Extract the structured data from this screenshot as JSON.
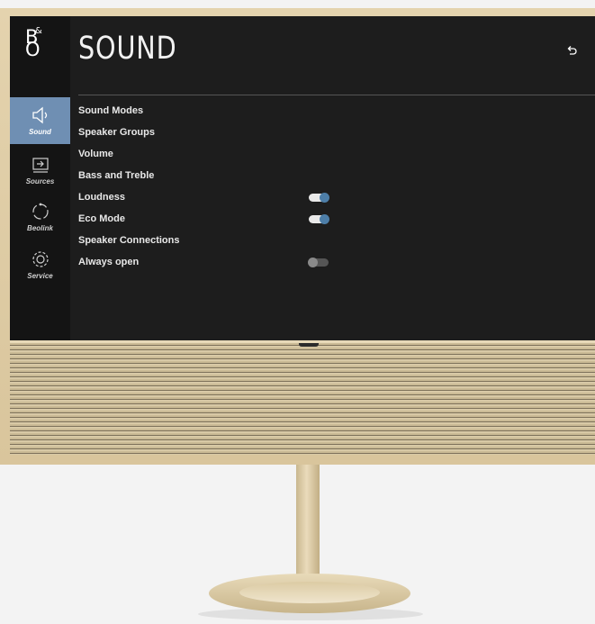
{
  "brand": {
    "logo_text": "B&O"
  },
  "page": {
    "title": "SOUND"
  },
  "sidebar": {
    "items": [
      {
        "label": "Sound",
        "icon": "speaker-icon",
        "active": true
      },
      {
        "label": "Sources",
        "icon": "input-icon",
        "active": false
      },
      {
        "label": "Beolink",
        "icon": "beolink-icon",
        "active": false
      },
      {
        "label": "Service",
        "icon": "gear-icon",
        "active": false
      }
    ]
  },
  "menu": {
    "items": [
      {
        "label": "Sound Modes"
      },
      {
        "label": "Speaker Groups"
      },
      {
        "label": "Volume"
      },
      {
        "label": "Bass and Treble"
      },
      {
        "label": "Loudness",
        "toggle": true,
        "on": true
      },
      {
        "label": "Eco Mode",
        "toggle": true,
        "on": true
      },
      {
        "label": "Speaker Connections"
      },
      {
        "label": "Always open",
        "toggle": true,
        "on": false
      }
    ]
  },
  "colors": {
    "accent": "#6f8fb3",
    "toggle_on": "#4d7ea8",
    "screen_bg": "#1d1d1d"
  }
}
